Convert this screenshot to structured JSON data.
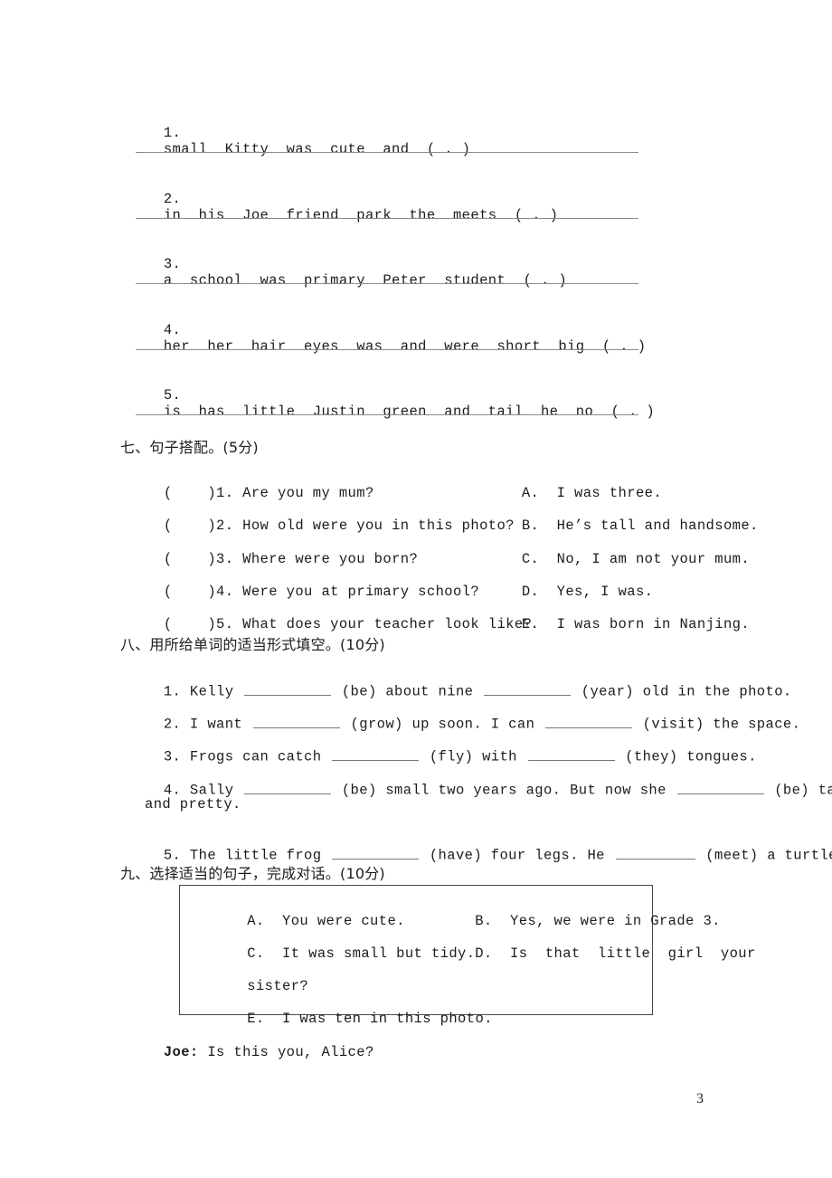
{
  "page": {
    "number": "3"
  },
  "rearrange": {
    "items": [
      {
        "number": "1.",
        "text": "small  Kitty  was  cute  and  ( . )"
      },
      {
        "number": "2.",
        "text": "in  his  Joe  friend  park  the  meets  ( . )"
      },
      {
        "number": "3.",
        "text": "a  school  was  primary  Peter  student  ( . )"
      },
      {
        "number": "4.",
        "text": "her  her  hair  eyes  was  and  were  short  big  ( . )"
      },
      {
        "number": "5.",
        "text": "is  has  little  Justin  green  and  tail  he  no  ( . )"
      }
    ]
  },
  "section7": {
    "heading": "七、句子搭配。(5分)",
    "left": [
      {
        "bracket": "(    )",
        "number": "1.",
        "text": "Are you my mum?"
      },
      {
        "bracket": "(    )",
        "number": "2.",
        "text": "How old were you in this photo?"
      },
      {
        "bracket": "(    )",
        "number": "3.",
        "text": "Where were you born?"
      },
      {
        "bracket": "(    )",
        "number": "4.",
        "text": "Were you at primary school?"
      },
      {
        "bracket": "(    )",
        "number": "5.",
        "text": "What does your teacher look like?"
      }
    ],
    "right": [
      {
        "letter": "A.",
        "text": "I was three."
      },
      {
        "letter": "B.",
        "text": "He’s tall and handsome."
      },
      {
        "letter": "C.",
        "text": "No, I am not your mum."
      },
      {
        "letter": "D.",
        "text": "Yes, I was."
      },
      {
        "letter": "E.",
        "text": "I was born in Nanjing."
      }
    ]
  },
  "section8": {
    "heading": "八、用所给单词的适当形式填空。(10分)",
    "items": [
      {
        "number": "1.",
        "parts": [
          "Kelly ",
          " (be) about nine ",
          " (year) old in the photo."
        ]
      },
      {
        "number": "2.",
        "parts": [
          "I want ",
          " (grow) up soon. I can ",
          " (visit) the space."
        ]
      },
      {
        "number": "3.",
        "parts": [
          "Frogs can catch ",
          " (fly) with ",
          " (they) tongues."
        ]
      },
      {
        "number": "4.",
        "parts": [
          "Sally ",
          " (be) small two years ago. But now she ",
          " (be) tall"
        ],
        "continuation": "and pretty."
      },
      {
        "number": "5.",
        "parts": [
          "The little frog ",
          " (have) four legs. He ",
          " (meet) a turtle."
        ]
      }
    ]
  },
  "section9": {
    "heading": "九、选择适当的句子，完成对话。(10分)",
    "options": [
      {
        "letter": "A.",
        "text": "You were cute."
      },
      {
        "letter": "B.",
        "text": "Yes, we were in Grade 3."
      },
      {
        "letter": "C.",
        "text": "It was small but tidy."
      },
      {
        "letter": "D.",
        "text": "Is  that  little  girl  your"
      },
      {
        "letter": "",
        "text": "sister?"
      },
      {
        "letter": "E.",
        "text": "I was ten in this photo."
      }
    ],
    "dialogue": [
      {
        "speaker": "Joe:",
        "text": " Is this you, Alice?"
      }
    ]
  }
}
